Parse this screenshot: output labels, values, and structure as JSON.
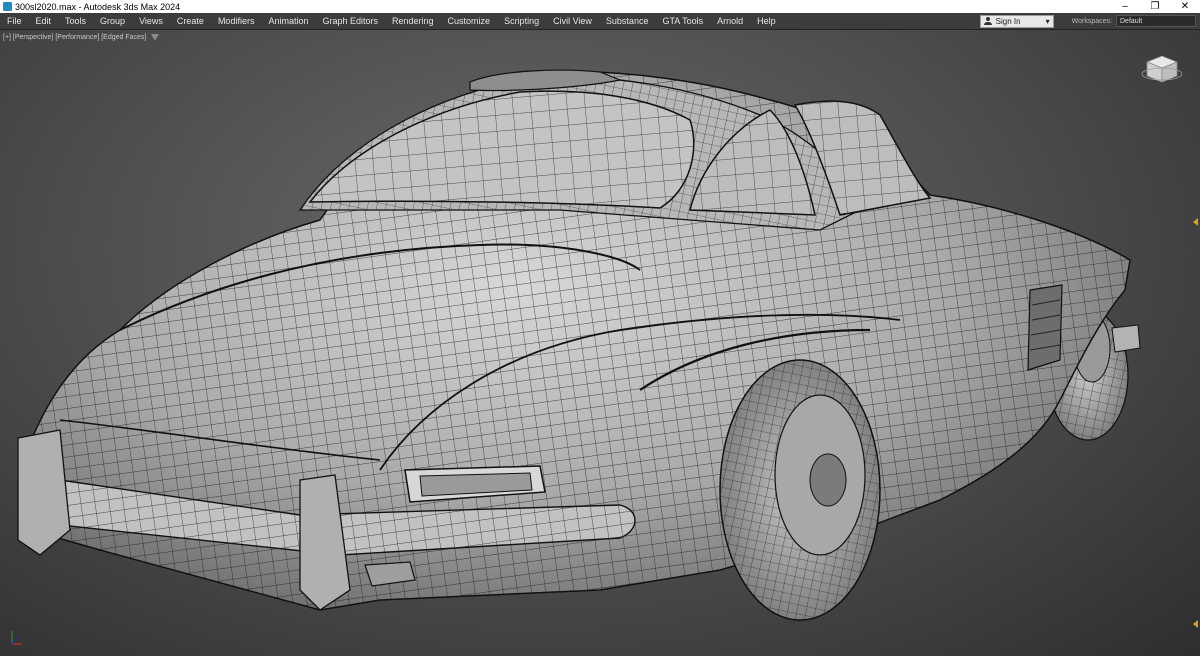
{
  "window": {
    "title": "300sl2020.max - Autodesk 3ds Max 2024",
    "minimize": "–",
    "maximize": "❐",
    "close": "✕"
  },
  "menu": {
    "items": [
      "File",
      "Edit",
      "Tools",
      "Group",
      "Views",
      "Create",
      "Modifiers",
      "Animation",
      "Graph Editors",
      "Rendering",
      "Customize",
      "Scripting",
      "Civil View",
      "Substance",
      "GTA Tools",
      "Arnold",
      "Help"
    ]
  },
  "account": {
    "sign_in": "Sign In",
    "dropdown_arrow": "▾"
  },
  "workspace": {
    "label": "Workspaces:",
    "value": "Default"
  },
  "viewport": {
    "label": "[+] [Perspective] [Performance] [Edged Faces]",
    "accent": "#d9a21b"
  }
}
